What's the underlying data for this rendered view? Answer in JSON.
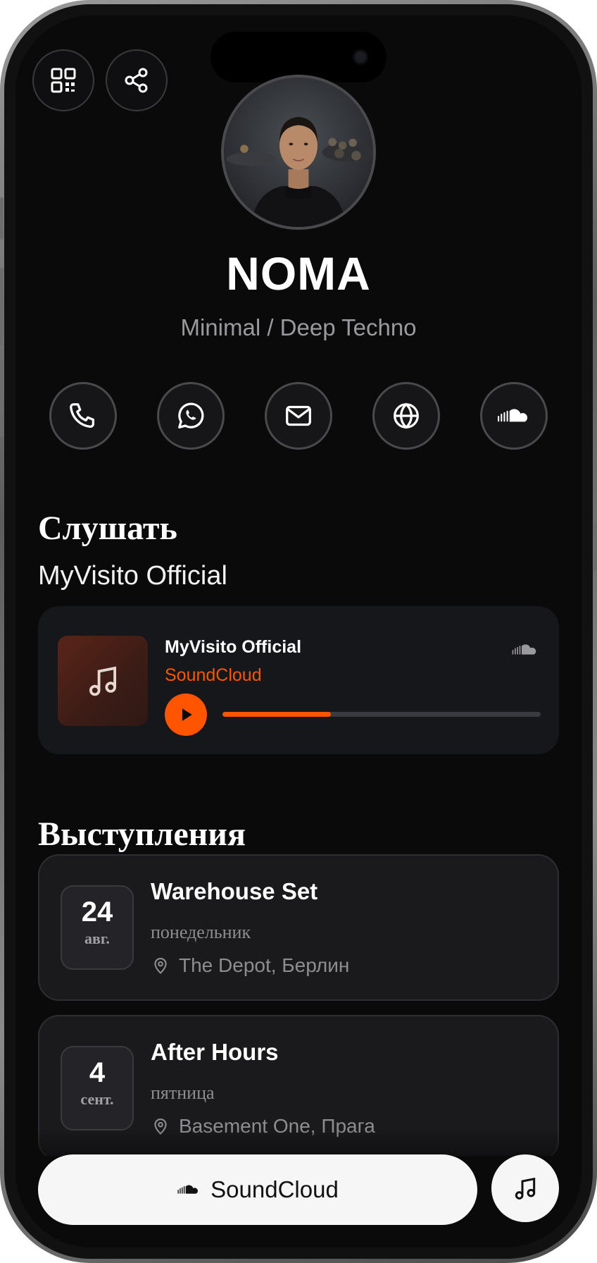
{
  "profile": {
    "name": "NOMA",
    "genre": "Minimal / Deep Techno"
  },
  "top_actions": [
    {
      "icon": "qr-code-icon"
    },
    {
      "icon": "share-icon"
    }
  ],
  "contacts": [
    {
      "icon": "phone-icon"
    },
    {
      "icon": "whatsapp-icon"
    },
    {
      "icon": "mail-icon"
    },
    {
      "icon": "globe-icon"
    },
    {
      "icon": "soundcloud-icon"
    }
  ],
  "listen": {
    "section_title": "Слушать",
    "playlist_name": "MyVisito Official",
    "player": {
      "track_title": "MyVisito Official",
      "source": "SoundCloud",
      "progress": 0.34
    }
  },
  "events": {
    "section_title": "Выступления",
    "items": [
      {
        "day": "24",
        "month": "авг.",
        "title": "Warehouse Set",
        "weekday": "понедельник",
        "venue": "The Depot, Берлин"
      },
      {
        "day": "4",
        "month": "сент.",
        "title": "After Hours",
        "weekday": "пятница",
        "venue": "Basement One, Прага"
      }
    ]
  },
  "bottom": {
    "listen_button": "SoundCloud"
  },
  "colors": {
    "accent": "#ff5500",
    "background": "#0a0a0b",
    "card": "#16171b"
  }
}
